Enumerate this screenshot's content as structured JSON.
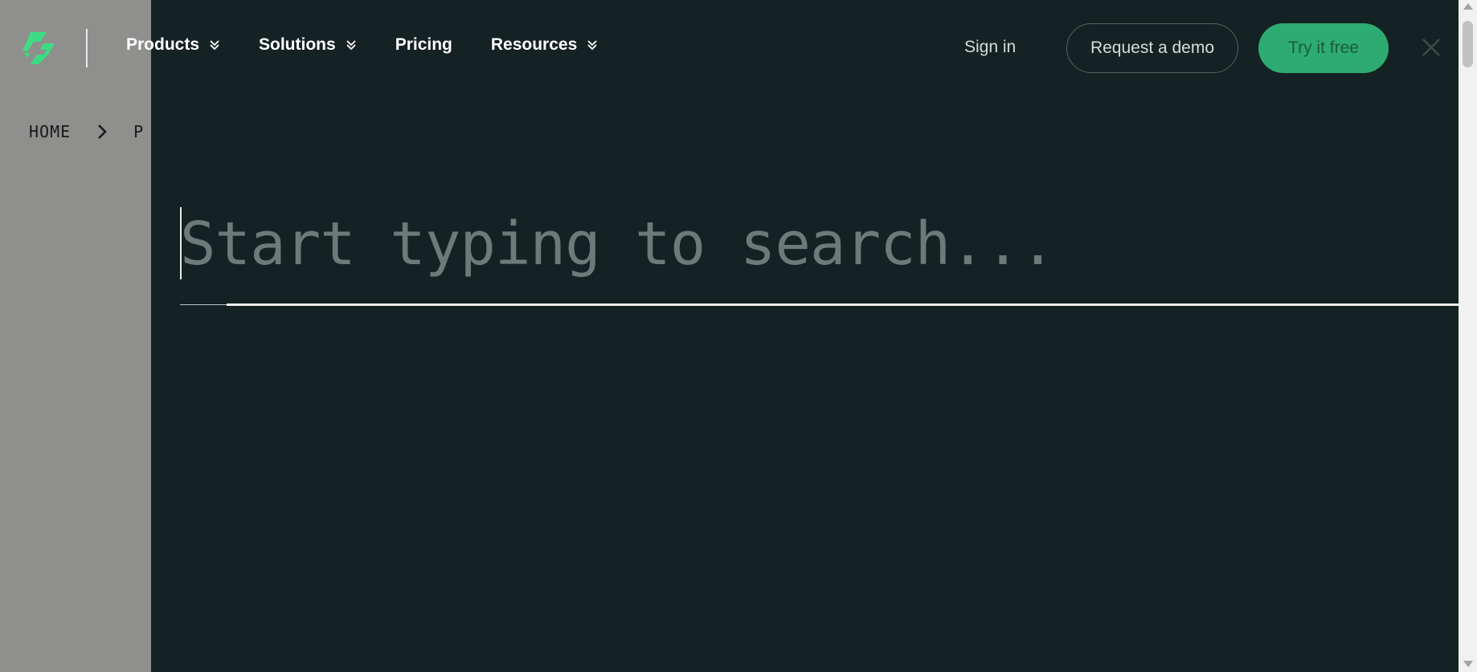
{
  "nav": {
    "items": [
      {
        "label": "Products",
        "has_dropdown": true
      },
      {
        "label": "Solutions",
        "has_dropdown": true
      },
      {
        "label": "Pricing",
        "has_dropdown": false
      },
      {
        "label": "Resources",
        "has_dropdown": true
      }
    ],
    "sign_in": "Sign in",
    "request_demo": "Request a demo",
    "try_free": "Try it free"
  },
  "breadcrumb": {
    "home": "HOME",
    "current": "P"
  },
  "search": {
    "placeholder": "Start typing to search...",
    "value": ""
  },
  "colors": {
    "overlay_bg": "#142223",
    "accent": "#2dab71",
    "logo": "#3ddc84",
    "dimmed_page": "#8f8f8d"
  },
  "icons": {
    "logo": "brand-logo-icon",
    "dropdown": "double-chevron-down-icon",
    "breadcrumb_sep": "chevron-right-icon",
    "close": "close-icon"
  }
}
